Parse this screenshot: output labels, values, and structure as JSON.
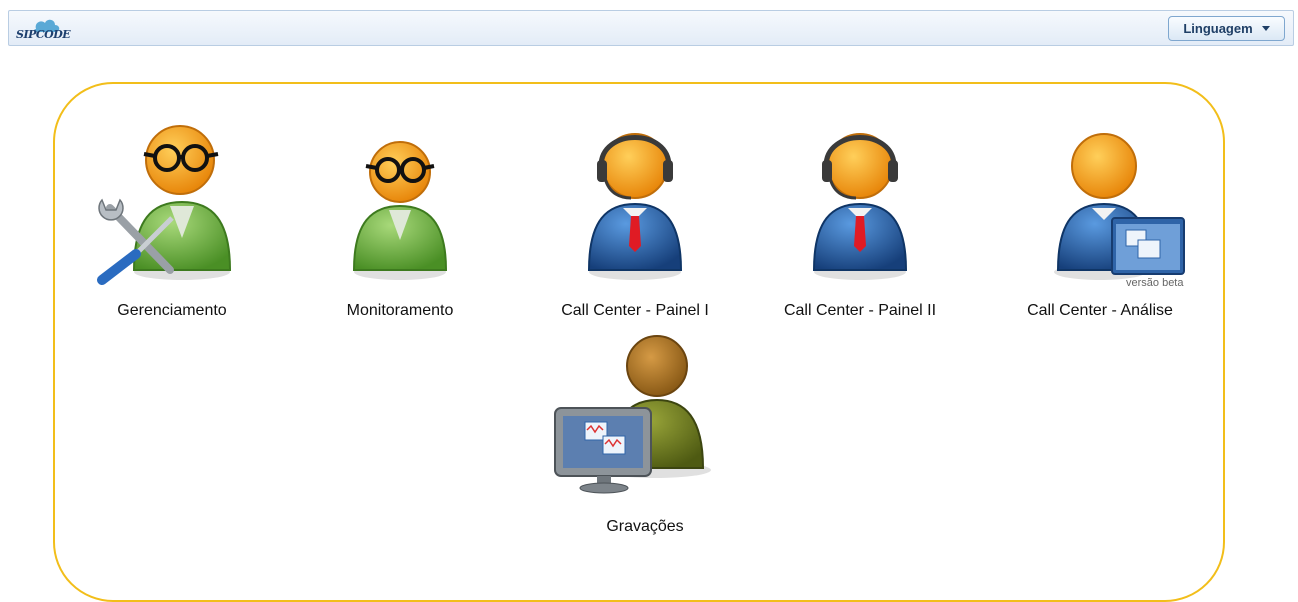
{
  "header": {
    "logo_text": "SIPCODE",
    "language_label": "Linguagem"
  },
  "modules": [
    {
      "label": "Gerenciamento",
      "icon": "admin-user-wrench-icon"
    },
    {
      "label": "Monitoramento",
      "icon": "monitor-user-glasses-icon"
    },
    {
      "label": "Call Center - Painel I",
      "icon": "headset-agent-icon"
    },
    {
      "label": "Call Center - Painel II",
      "icon": "headset-agent-icon"
    },
    {
      "label": "Call Center - Análise",
      "icon": "analyst-window-icon",
      "badge": "versão beta"
    },
    {
      "label": "Gravações",
      "icon": "recordings-monitor-icon"
    }
  ],
  "colors": {
    "panel_border": "#f2be1a",
    "header_border": "#b9cde3",
    "head_orange": "#f39a12",
    "body_green": "#6fb043",
    "body_blue": "#1f5fa3",
    "body_olive": "#6b7a1e"
  }
}
